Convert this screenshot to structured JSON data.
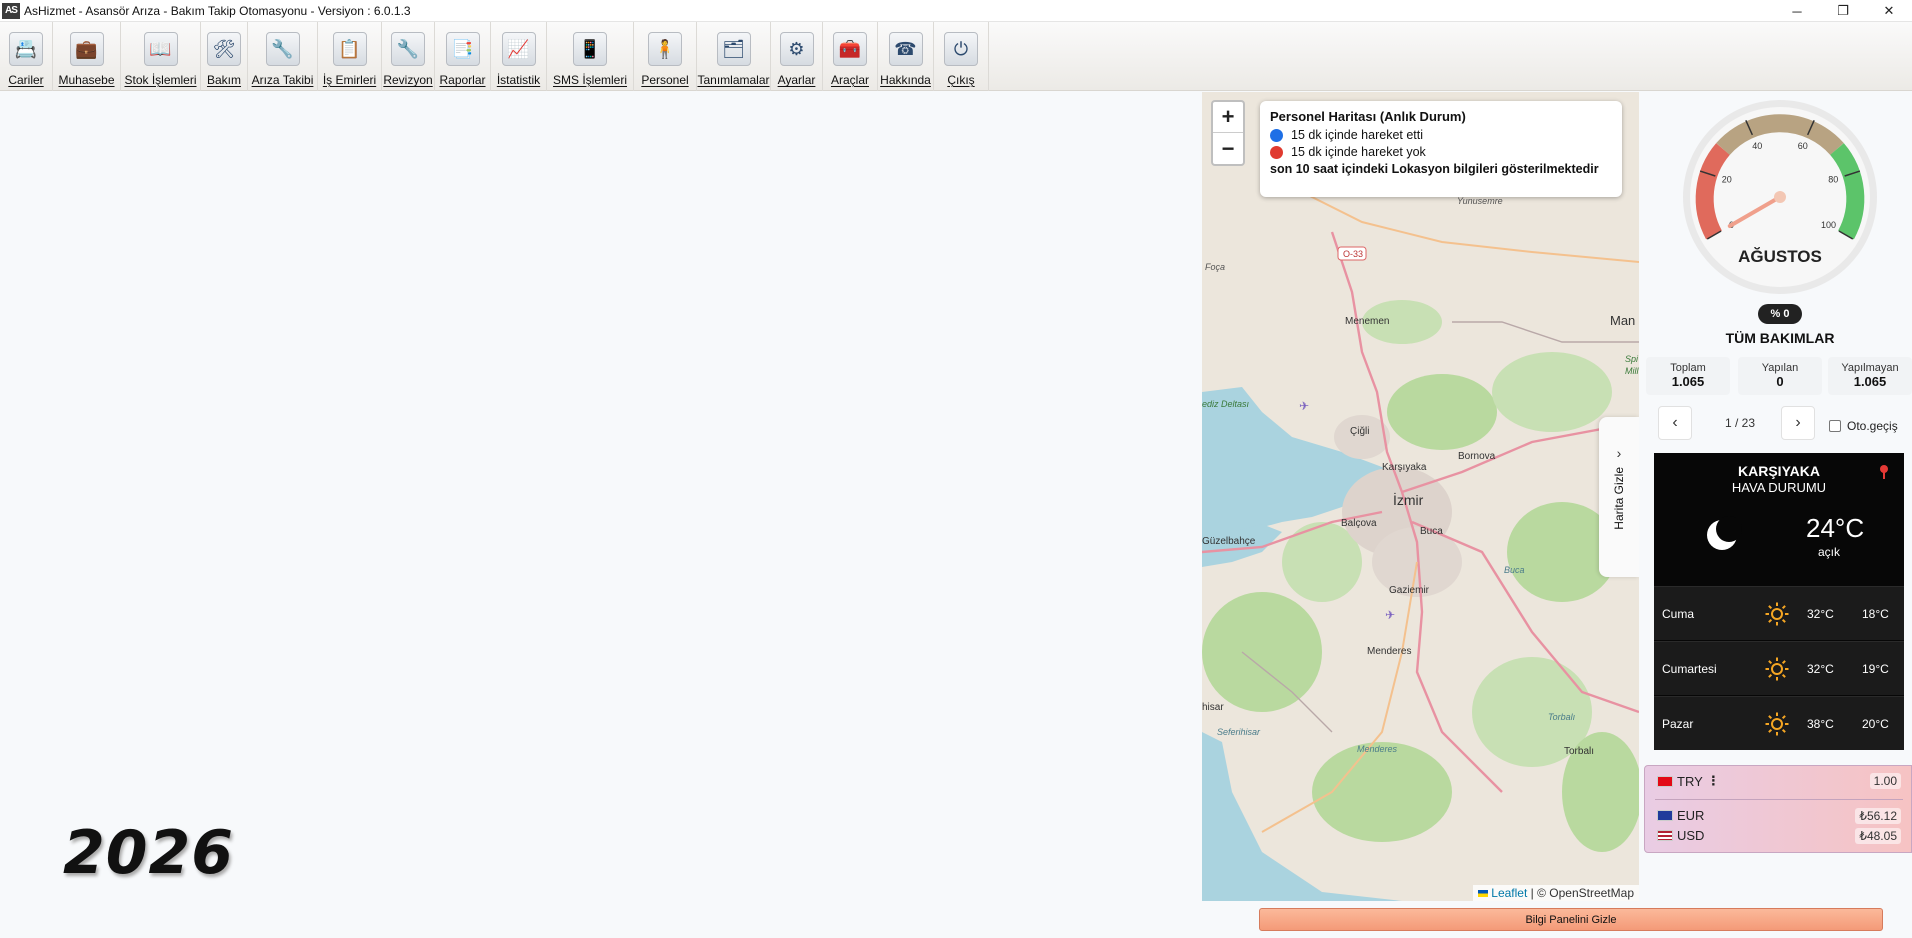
{
  "window": {
    "logo": "AS",
    "title": "AsHizmet - Asansör Arıza - Bakım Takip Otomasyonu - Versiyon : 6.0.1.3",
    "minimize": "─",
    "restore": "❐",
    "close": "✕"
  },
  "toolbar": [
    {
      "label": "Cariler",
      "icon": "address-book-icon",
      "glyph": "📇",
      "width": 53
    },
    {
      "label": "Muhasebe",
      "icon": "briefcase-icon",
      "glyph": "💼",
      "width": 68
    },
    {
      "label": "Stok İşlemleri",
      "icon": "book-icon",
      "glyph": "📖",
      "width": 80
    },
    {
      "label": "Bakım",
      "icon": "tools-icon",
      "glyph": "🛠",
      "width": 47
    },
    {
      "label": "Arıza Takibi",
      "icon": "wrench-screwdriver-icon",
      "glyph": "🔧",
      "width": 70
    },
    {
      "label": "İş Emirleri",
      "icon": "document-icon",
      "glyph": "📋",
      "width": 64
    },
    {
      "label": "Revizyon",
      "icon": "wrench-icon",
      "glyph": "🔧",
      "width": 53
    },
    {
      "label": "Raporlar",
      "icon": "reports-icon",
      "glyph": "📑",
      "width": 56
    },
    {
      "label": "İstatistik",
      "icon": "chart-icon",
      "glyph": "📈",
      "width": 56
    },
    {
      "label": "SMS İşlemleri",
      "icon": "phone-icon",
      "glyph": "📱",
      "width": 87
    },
    {
      "label": "Personel",
      "icon": "person-icon",
      "glyph": "🧍",
      "width": 63
    },
    {
      "label": "Tanımlamalar",
      "icon": "definitions-icon",
      "glyph": "🗂",
      "width": 74
    },
    {
      "label": "Ayarlar",
      "icon": "gears-icon",
      "glyph": "⚙",
      "width": 52
    },
    {
      "label": "Araçlar",
      "icon": "toolbox-icon",
      "glyph": "🧰",
      "width": 55
    },
    {
      "label": "Hakkında",
      "icon": "telephone-icon",
      "glyph": "☎",
      "width": 56
    },
    {
      "label": "Çıkış",
      "icon": "power-icon",
      "glyph": "⏻",
      "width": 55
    }
  ],
  "year": "2026",
  "map": {
    "zoom_in": "+",
    "zoom_out": "−",
    "legend_title": "Personel Haritası (Anlık Durum)",
    "legend_moved": "15 dk içinde hareket etti",
    "legend_not_moved": "15 dk içinde hareket yok",
    "legend_note": "son 10 saat içindeki Lokasyon bilgileri gösterilmektedir",
    "hide_map": "Harita Gizle",
    "hide_map_chevron": "›",
    "attribution_leaflet": "Leaflet",
    "attribution_rest": " | © OpenStreetMap",
    "places": {
      "yunusemre": "Yunusemre",
      "o33": "O-33",
      "foca": "Foça",
      "menemen": "Menemen",
      "man": "Man",
      "spi": "Spi",
      "mill": "Mill",
      "gediz": "ediz Deltası",
      "cigli": "Çiğli",
      "bornova": "Bornova",
      "karsiyaka": "Karşıyaka",
      "izmir": "İzmir",
      "balcova": "Balçova",
      "buca": "Buca",
      "buca2": "Buca",
      "guzelbahce": "Güzelbahçe",
      "gaziemir": "Gaziemir",
      "menderes": "Menderes",
      "menderes2": "Menderes",
      "hisar": "hisar",
      "seferihisar": "Seferihisar",
      "torbali": "Torbalı",
      "torbali2": "Torbalı"
    },
    "colors": {
      "moved": "#1e6fe6",
      "not_moved": "#e03a2f"
    }
  },
  "gauge": {
    "month": "AĞUSTOS",
    "value": 0,
    "ticks": [
      "0",
      "20",
      "40",
      "60",
      "80",
      "100"
    ]
  },
  "summary": {
    "percent": "% 0",
    "title": "TÜM BAKIMLAR",
    "total_label": "Toplam",
    "total": "1.065",
    "done_label": "Yapılan",
    "done": "0",
    "undone_label": "Yapılmayan",
    "undone": "1.065"
  },
  "pager": {
    "prev": "‹",
    "next": "›",
    "text": "1 / 23",
    "auto_label": "Oto.geçiş"
  },
  "weather": {
    "city": "KARŞIYAKA",
    "subtitle": "HAVA DURUMU",
    "temp": "24°C",
    "desc": "açık",
    "days": [
      {
        "day": "Cuma",
        "hi": "32°C",
        "lo": "18°C"
      },
      {
        "day": "Cumartesi",
        "hi": "32°C",
        "lo": "19°C"
      },
      {
        "day": "Pazar",
        "hi": "38°C",
        "lo": "20°C"
      }
    ]
  },
  "currency": {
    "base": "TRY",
    "base_menu": "⋮",
    "base_value": "1.00",
    "rows": [
      {
        "code": "EUR",
        "value": "₺56.12"
      },
      {
        "code": "USD",
        "value": "₺48.05"
      }
    ]
  },
  "hide_panel": "Bilgi Panelini Gizle"
}
